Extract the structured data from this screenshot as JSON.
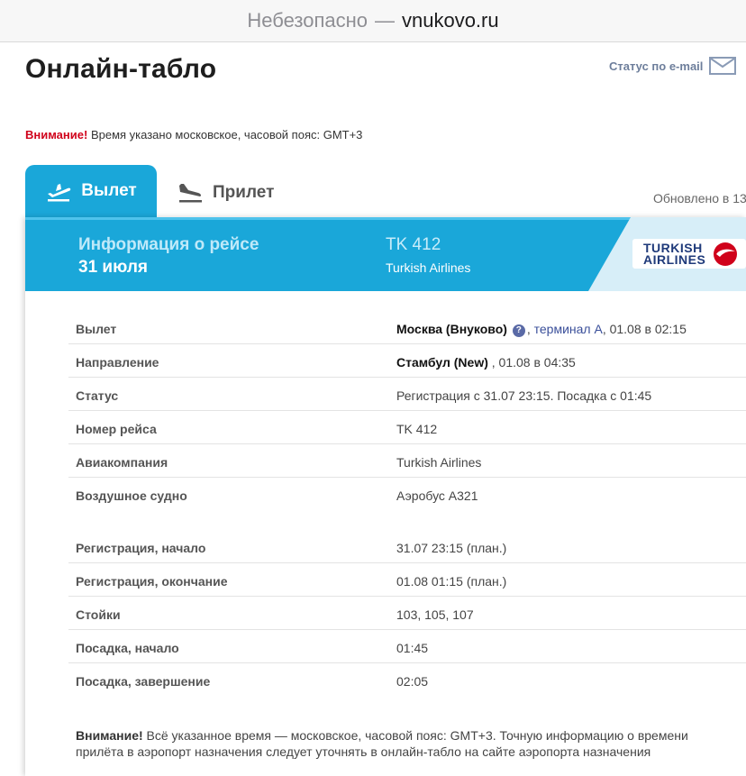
{
  "browser": {
    "insecure_label": "Небезопасно",
    "separator": "—",
    "domain": "vnukovo.ru"
  },
  "header": {
    "title": "Онлайн-табло",
    "email_status_label": "Статус по e-mail"
  },
  "notice": {
    "label": "Внимание!",
    "text": "Время указано московское, часовой пояс: GMT+3"
  },
  "tabs": {
    "departure": "Вылет",
    "arrival": "Прилет",
    "active": "departure"
  },
  "updated_label": "Обновлено в 13",
  "flight": {
    "section_title": "Информация о рейсе",
    "date": "31 июля",
    "number": "TK 412",
    "airline": "Turkish Airlines",
    "logo_line1": "TURKISH",
    "logo_line2": "AIRLINES"
  },
  "details": {
    "departure_label": "Вылет",
    "departure_airport": "Москва (Внуково)",
    "departure_help": "?",
    "departure_terminal": "терминал A",
    "departure_time": ", 01.08 в 02:15",
    "direction_label": "Направление",
    "direction_airport": "Стамбул (New)",
    "direction_time": " , 01.08 в 04:35",
    "status_label": "Статус",
    "status_value": "Регистрация с 31.07 23:15. Посадка с 01:45",
    "flight_no_label": "Номер рейса",
    "flight_no_value": "TK 412",
    "airline_label": "Авиакомпания",
    "airline_value": "Turkish Airlines",
    "aircraft_label": "Воздушное судно",
    "aircraft_value": "Аэробус A321",
    "checkin_start_label": "Регистрация, начало",
    "checkin_start_value": "31.07 23:15 (план.)",
    "checkin_end_label": "Регистрация, окончание",
    "checkin_end_value": "01.08 01:15 (план.)",
    "counters_label": "Стойки",
    "counters_value": "103, 105, 107",
    "boarding_start_label": "Посадка, начало",
    "boarding_start_value": "01:45",
    "boarding_end_label": "Посадка, завершение",
    "boarding_end_value": "02:05"
  },
  "footnote": {
    "label": "Внимание!",
    "text": " Всё указанное время — московское, часовой пояс: GMT+3. Точную информацию о времени прилёта в аэропорт назначения следует уточнять в онлайн-табло на сайте аэропорта назначения"
  },
  "colors": {
    "accent": "#1aa7d9",
    "warning": "#d0021b",
    "link": "#3a4f9a"
  }
}
